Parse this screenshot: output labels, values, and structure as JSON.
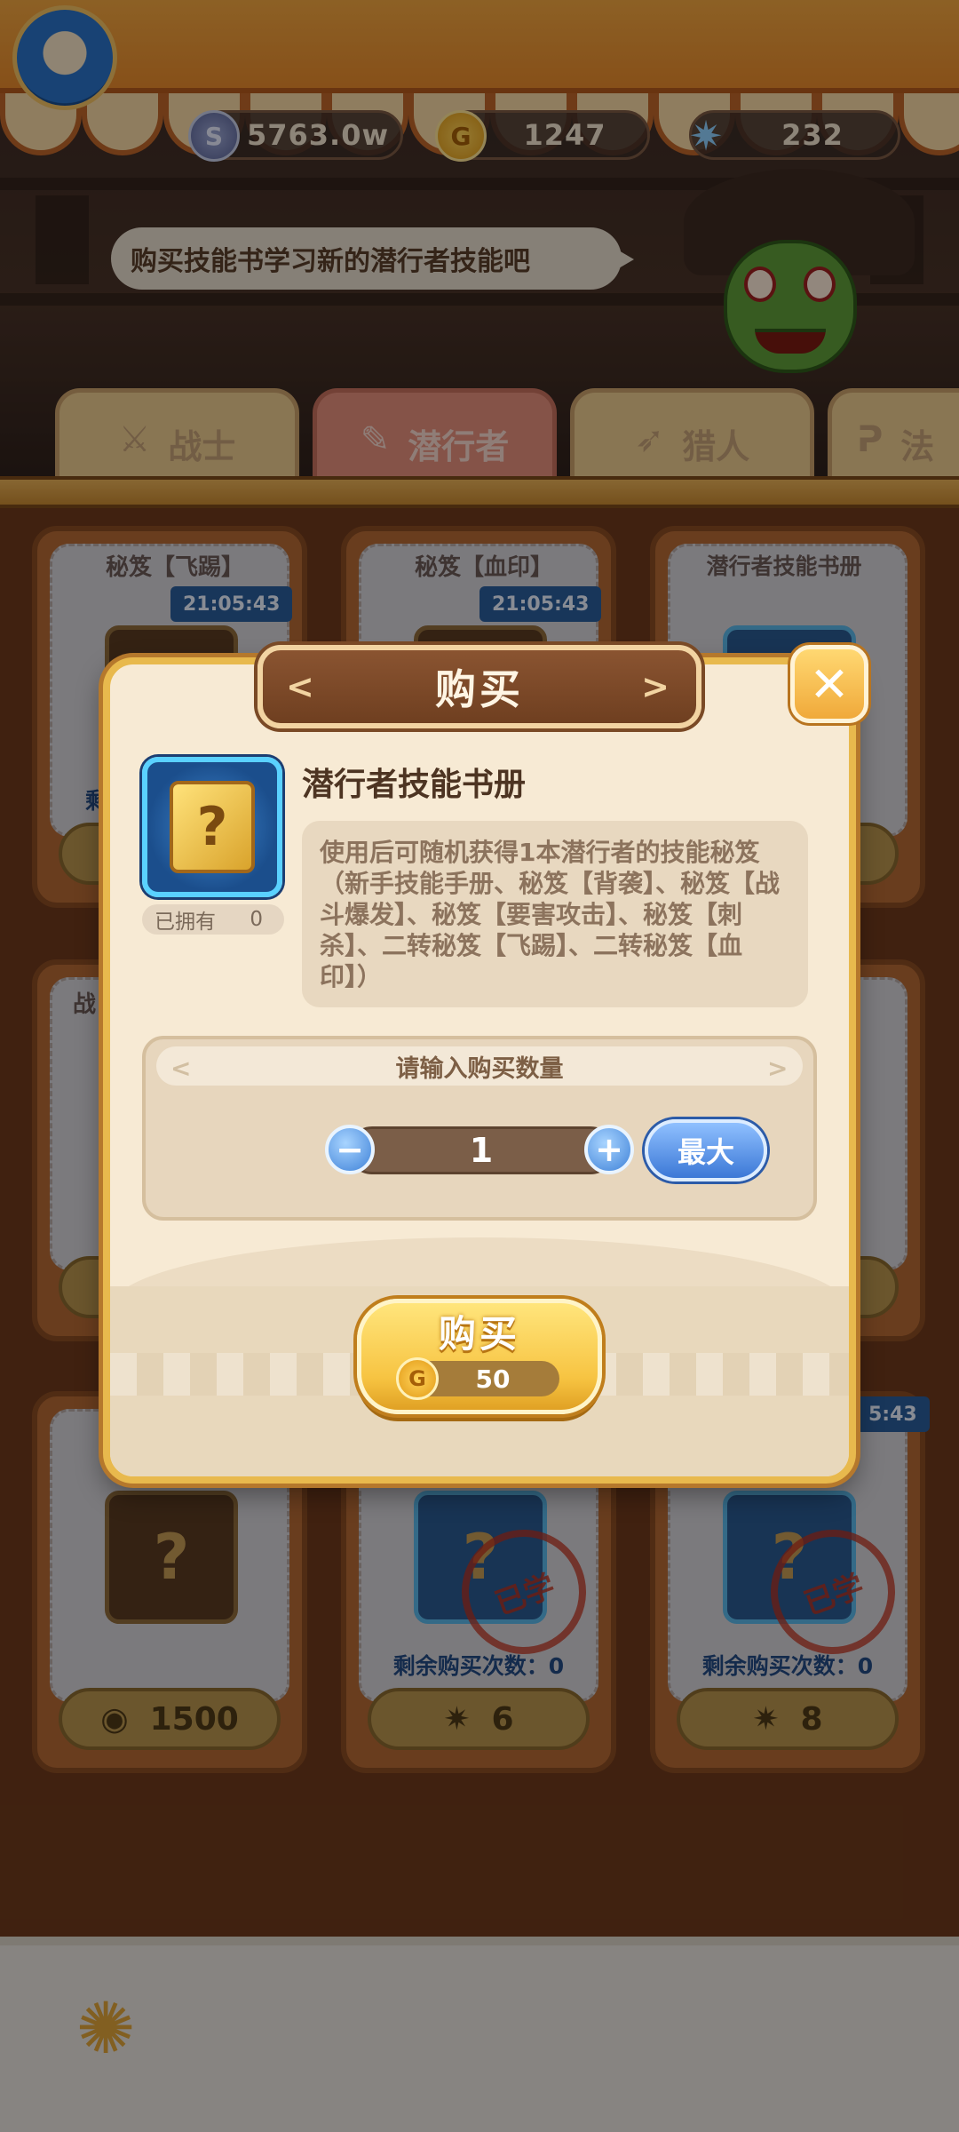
{
  "resources": {
    "silver": "5763.0w",
    "gold": "1247",
    "gem": "232"
  },
  "npc": {
    "speech": "购买技能书学习新的潜行者技能吧"
  },
  "tabs": [
    {
      "label": "战士",
      "active": false
    },
    {
      "label": "潜行者",
      "active": true
    },
    {
      "label": "猎人",
      "active": false
    },
    {
      "label": "法",
      "active": false
    }
  ],
  "shop_cards": [
    {
      "title": "秘笈【飞踢】",
      "timer": "21:05:43",
      "remain": "剩",
      "price": ""
    },
    {
      "title": "秘笈【血印】",
      "timer": "21:05:43",
      "remain": "",
      "price": ""
    },
    {
      "title": "潜行者技能书册",
      "timer": "",
      "remain": "",
      "price": ""
    },
    {
      "title": "战",
      "timer": "",
      "remain": "",
      "price": ""
    },
    {
      "title": "",
      "timer": "",
      "remain": "",
      "price": "1500"
    },
    {
      "title": "",
      "timer": "",
      "remain": "剩余购买次数：0",
      "price": "6",
      "learned": "已学"
    },
    {
      "title": "",
      "timer": "5:43",
      "remain": "剩余购买次数：0",
      "price": "8",
      "learned": "已学"
    }
  ],
  "modal": {
    "title": "购买",
    "close_label": "✕",
    "item_name": "潜行者技能书册",
    "owned_label": "已拥有",
    "owned_count": "0",
    "description": "使用后可随机获得1本潜行者的技能秘笈（新手技能手册、秘笈【背袭】、秘笈【战斗爆发】、秘笈【要害攻击】、秘笈【刺杀】、二转秘笈【飞踢】、二转秘笈【血印】）",
    "quantity_prompt": "请输入购买数量",
    "quantity": "1",
    "minus_label": "−",
    "plus_label": "+",
    "max_label": "最大",
    "buy_label": "购买",
    "buy_price": "50"
  },
  "colors": {
    "gold_accent": "#e8b94d",
    "modal_bg": "#f7ead4",
    "blue_button": "#3c78d6",
    "buy_button": "#f7c442"
  }
}
